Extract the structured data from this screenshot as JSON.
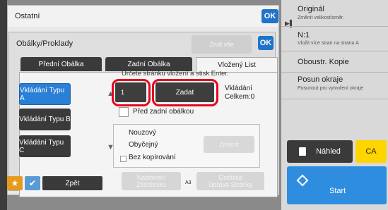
{
  "ostatni": {
    "title": "Ostatní",
    "ok_label": "OK"
  },
  "obalky": {
    "title": "Obálky/Proklady",
    "zrus_label": "Zruš vše",
    "ok_label": "OK",
    "tabs": [
      "Přední Obálka",
      "Zadní Obálka",
      "Vložený List"
    ],
    "instruction": "Určete stránku vložení a stisk Enter.",
    "types": [
      "Vkládání Typu A",
      "Vkládání Typu B",
      "Vkládání Typu C"
    ],
    "page_value": "1",
    "zadat_label": "Zadat",
    "total_line1": "Vkládání",
    "total_line2": "Celkem:0",
    "pred_zadni": "Před zadní obálkou",
    "options": [
      "Nouzový",
      "Obyčejný",
      "Bez kopírování"
    ],
    "zmenit_label": "Změnit",
    "nastaveni_line1": "Nastavení",
    "nastaveni_line2": "Zásobníku",
    "graficka_line1": "Grafická",
    "graficka_line2": "Úprava Stránky"
  },
  "right_panel": {
    "original_title": "Originál",
    "original_sub": "Změnit velikost/směr.",
    "n1_title": "N:1",
    "n1_sub": "Vložit více stran na stranu A",
    "oboustr": "Oboustr. Kopie",
    "posun_title": "Posun okraje",
    "posun_sub": "Posunout pro vytvoření okraje",
    "nahled": "Náhled",
    "ca": "CA",
    "start": "Start"
  },
  "bottom": {
    "zpet_label": "Zpět",
    "paper_size": "A3"
  },
  "colors": {
    "accent_blue": "#1f74c9",
    "highlight_red": "#e4071e",
    "ca_yellow": "#ffd500",
    "start_blue": "#2f8de0"
  }
}
